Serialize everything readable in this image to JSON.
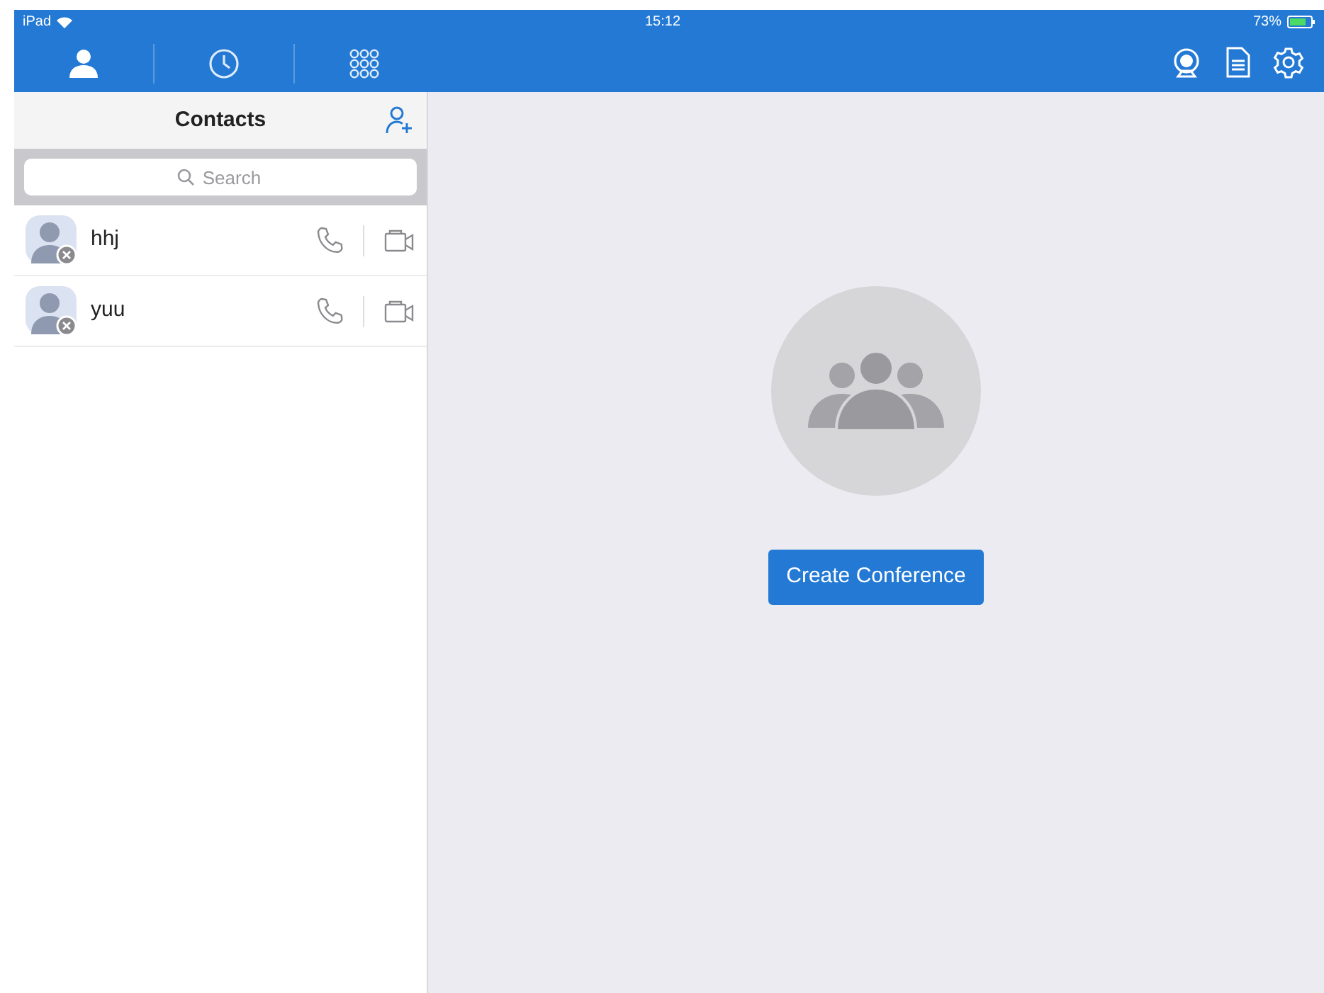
{
  "status_bar": {
    "device": "iPad",
    "time": "15:12",
    "battery": "73%"
  },
  "tabs": [
    {
      "kind": "person",
      "selected": true
    },
    {
      "kind": "clock",
      "selected": false
    },
    {
      "kind": "dialpad",
      "selected": false
    }
  ],
  "contacts_panel": {
    "title": "Contacts",
    "search": {
      "placeholder": "Search"
    },
    "contacts": [
      {
        "name": "hhj"
      },
      {
        "name": "yuu"
      }
    ]
  },
  "main": {
    "button": "Create Conference"
  }
}
